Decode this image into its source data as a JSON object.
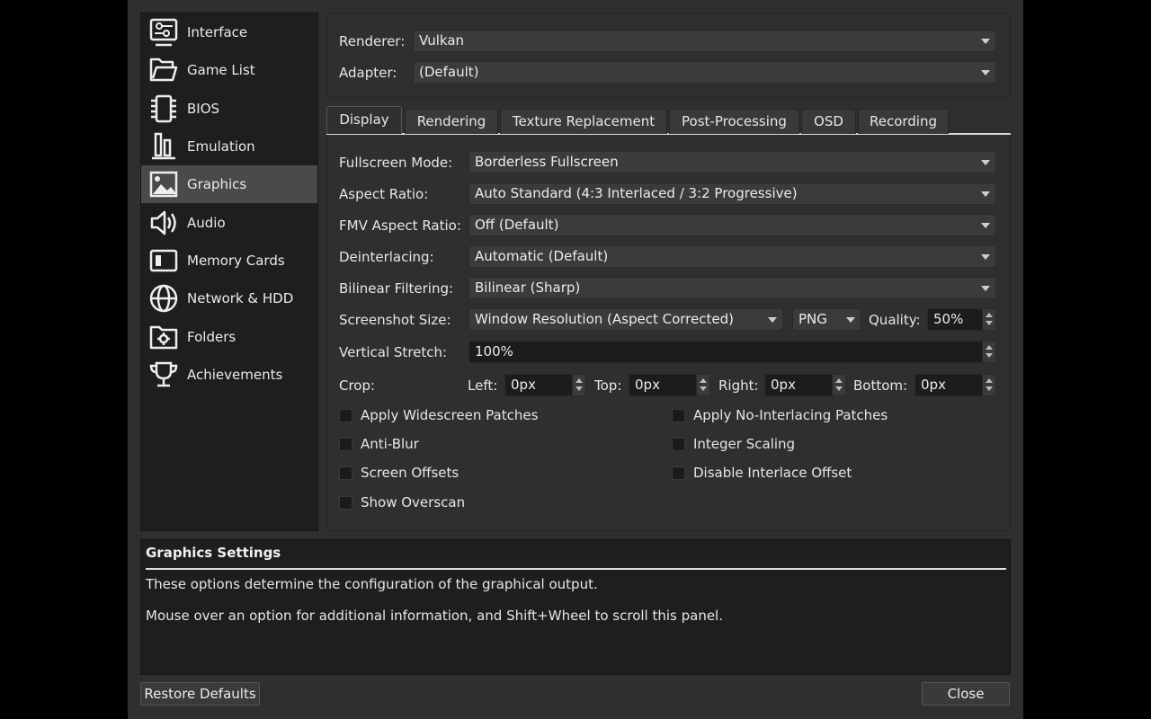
{
  "sidebar": {
    "items": [
      {
        "label": "Interface",
        "icon": "interface-icon"
      },
      {
        "label": "Game List",
        "icon": "folder-icon"
      },
      {
        "label": "BIOS",
        "icon": "chip-icon"
      },
      {
        "label": "Emulation",
        "icon": "columns-icon"
      },
      {
        "label": "Graphics",
        "icon": "image-icon"
      },
      {
        "label": "Audio",
        "icon": "speaker-icon"
      },
      {
        "label": "Memory Cards",
        "icon": "memory-card-icon"
      },
      {
        "label": "Network & HDD",
        "icon": "globe-icon"
      },
      {
        "label": "Folders",
        "icon": "folder-gear-icon"
      },
      {
        "label": "Achievements",
        "icon": "trophy-icon"
      }
    ],
    "active": "Graphics"
  },
  "top": {
    "renderer_label": "Renderer:",
    "renderer_value": "Vulkan",
    "adapter_label": "Adapter:",
    "adapter_value": "(Default)"
  },
  "tabs": [
    "Display",
    "Rendering",
    "Texture Replacement",
    "Post-Processing",
    "OSD",
    "Recording"
  ],
  "active_tab": "Display",
  "display": {
    "fullscreen_mode_label": "Fullscreen Mode:",
    "fullscreen_mode_value": "Borderless Fullscreen",
    "aspect_ratio_label": "Aspect Ratio:",
    "aspect_ratio_value": "Auto Standard (4:3 Interlaced / 3:2 Progressive)",
    "fmv_aspect_label": "FMV Aspect Ratio:",
    "fmv_aspect_value": "Off (Default)",
    "deinterlacing_label": "Deinterlacing:",
    "deinterlacing_value": "Automatic (Default)",
    "bilinear_label": "Bilinear Filtering:",
    "bilinear_value": "Bilinear (Sharp)",
    "screenshot_size_label": "Screenshot Size:",
    "screenshot_size_value": "Window Resolution (Aspect Corrected)",
    "screenshot_format_value": "PNG",
    "quality_label": "Quality:",
    "quality_value": "50%",
    "vertical_stretch_label": "Vertical Stretch:",
    "vertical_stretch_value": "100%",
    "crop_label": "Crop:",
    "crop_left_label": "Left:",
    "crop_left_value": "0px",
    "crop_top_label": "Top:",
    "crop_top_value": "0px",
    "crop_right_label": "Right:",
    "crop_right_value": "0px",
    "crop_bottom_label": "Bottom:",
    "crop_bottom_value": "0px",
    "checkboxes_left": [
      "Apply Widescreen Patches",
      "Anti-Blur",
      "Screen Offsets",
      "Show Overscan"
    ],
    "checkboxes_right": [
      "Apply No-Interlacing Patches",
      "Integer Scaling",
      "Disable Interlace Offset"
    ]
  },
  "description": {
    "title": "Graphics Settings",
    "line1": "These options determine the configuration of the graphical output.",
    "line2": "Mouse over an option for additional information, and Shift+Wheel to scroll this panel."
  },
  "buttons": {
    "restore": "Restore Defaults",
    "close": "Close"
  }
}
